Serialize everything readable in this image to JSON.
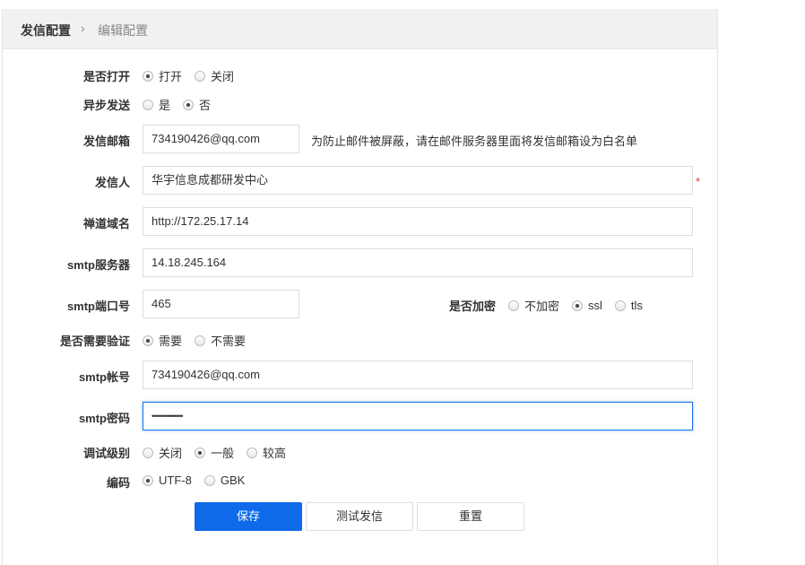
{
  "breadcrumb": {
    "root": "发信配置",
    "separator": "›",
    "current": "编辑配置"
  },
  "form": {
    "turn_on": {
      "label": "是否打开",
      "options": [
        "打开",
        "关闭"
      ],
      "selected": "打开"
    },
    "async": {
      "label": "异步发送",
      "options": [
        "是",
        "否"
      ],
      "selected": "否"
    },
    "sender_email": {
      "label": "发信邮箱",
      "value": "734190426@qq.com",
      "hint": "为防止邮件被屏蔽，请在邮件服务器里面将发信邮箱设为白名单"
    },
    "sender_name": {
      "label": "发信人",
      "value": "华宇信息成都研发中心",
      "required": "*"
    },
    "domain": {
      "label": "禅道域名",
      "value": "http://172.25.17.14"
    },
    "smtp_host": {
      "label": "smtp服务器",
      "value": "14.18.245.164"
    },
    "smtp_port": {
      "label": "smtp端口号",
      "value": "465"
    },
    "secure": {
      "label": "是否加密",
      "options": [
        "不加密",
        "ssl",
        "tls"
      ],
      "selected": "ssl"
    },
    "auth": {
      "label": "是否需要验证",
      "options": [
        "需要",
        "不需要"
      ],
      "selected": "需要"
    },
    "smtp_user": {
      "label": "smtp帐号",
      "value": "734190426@qq.com"
    },
    "smtp_pass": {
      "label": "smtp密码",
      "value": "••••••••••••••••"
    },
    "debug": {
      "label": "调试级别",
      "options": [
        "关闭",
        "一般",
        "较高"
      ],
      "selected": "一般"
    },
    "charset": {
      "label": "编码",
      "options": [
        "UTF-8",
        "GBK"
      ],
      "selected": "UTF-8"
    }
  },
  "buttons": {
    "save": "保存",
    "test": "测试发信",
    "reset": "重置"
  }
}
